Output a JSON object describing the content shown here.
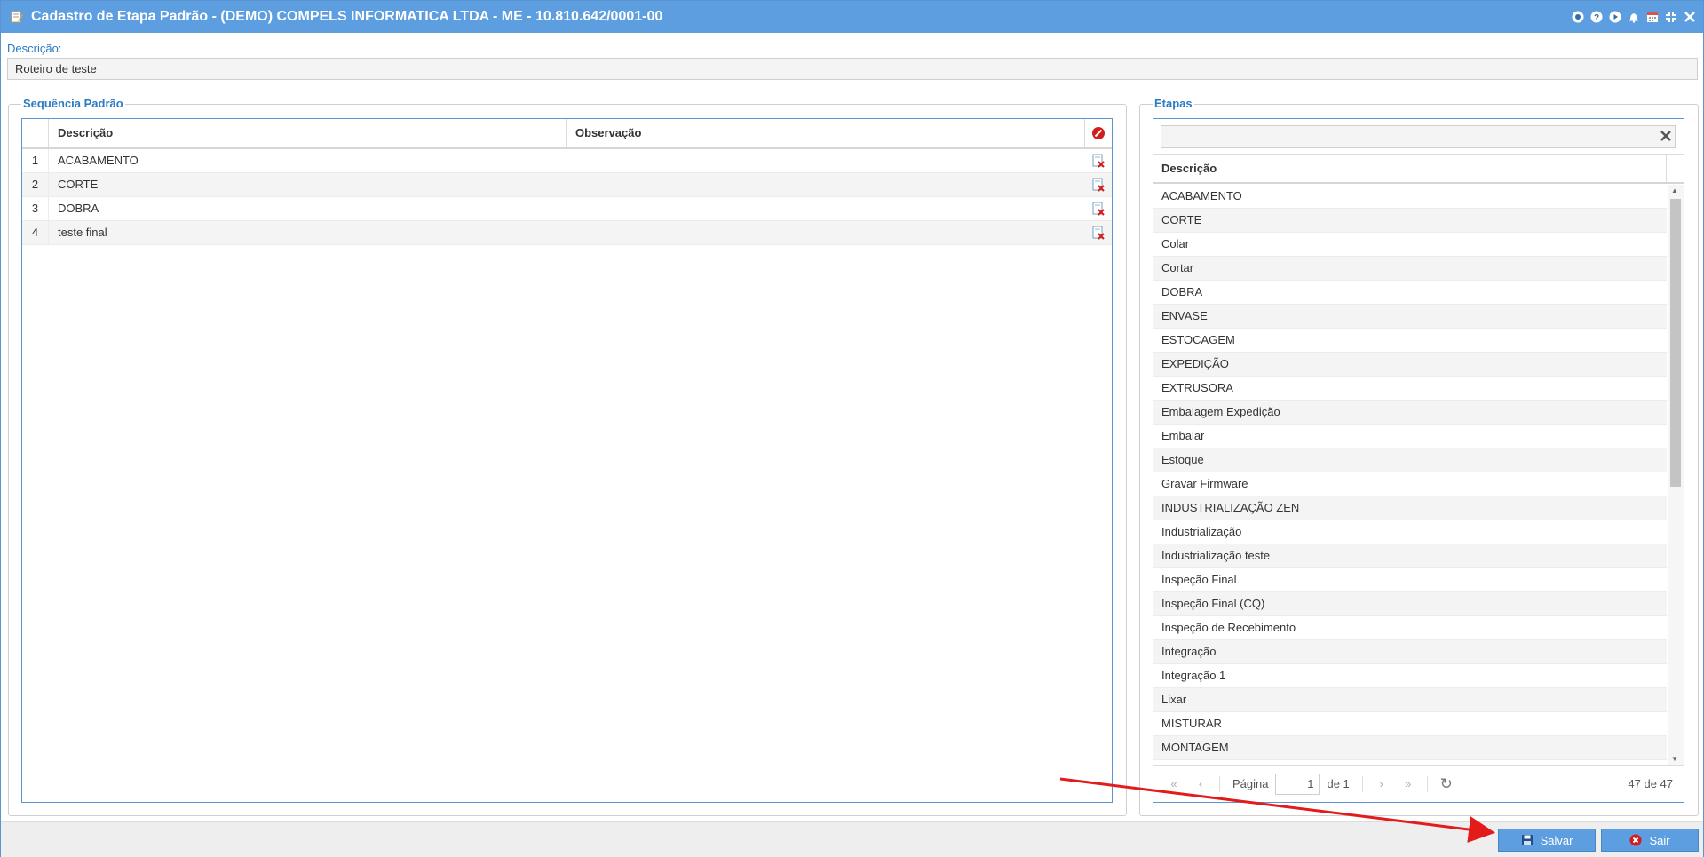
{
  "window": {
    "title": "Cadastro de Etapa Padrão - (DEMO) COMPELS INFORMATICA LTDA - ME - 10.810.642/0001-00"
  },
  "descricao": {
    "label": "Descrição:",
    "value": "Roteiro de teste"
  },
  "sequencia": {
    "legend": "Sequência Padrão",
    "columns": [
      "Descrição",
      "Observação"
    ],
    "rows": [
      {
        "n": "1",
        "descricao": "ACABAMENTO",
        "observacao": ""
      },
      {
        "n": "2",
        "descricao": "CORTE",
        "observacao": ""
      },
      {
        "n": "3",
        "descricao": "DOBRA",
        "observacao": ""
      },
      {
        "n": "4",
        "descricao": "teste final",
        "observacao": ""
      }
    ]
  },
  "etapas": {
    "legend": "Etapas",
    "search_value": "",
    "column": "Descrição",
    "items": [
      "ACABAMENTO",
      "CORTE",
      "Colar",
      "Cortar",
      "DOBRA",
      "ENVASE",
      "ESTOCAGEM",
      "EXPEDIÇÃO",
      "EXTRUSORA",
      "Embalagem Expedição",
      "Embalar",
      "Estoque",
      "Gravar Firmware",
      "INDUSTRIALIZAÇÃO ZEN",
      "Industrialização",
      "Industrialização teste",
      "Inspeção Final",
      "Inspeção Final (CQ)",
      "Inspeção de Recebimento",
      "Integração",
      "Integração 1",
      "Lixar",
      "MISTURAR",
      "MONTAGEM"
    ],
    "pager": {
      "page_label": "Página",
      "page_value": "1",
      "of_label": "de 1",
      "count": "47 de 47"
    }
  },
  "buttons": {
    "save": "Salvar",
    "exit": "Sair"
  },
  "colors": {
    "titlebar": "#5d9ee0",
    "accent": "#2a7bc4",
    "annotation_arrow": "#e31b1b"
  }
}
